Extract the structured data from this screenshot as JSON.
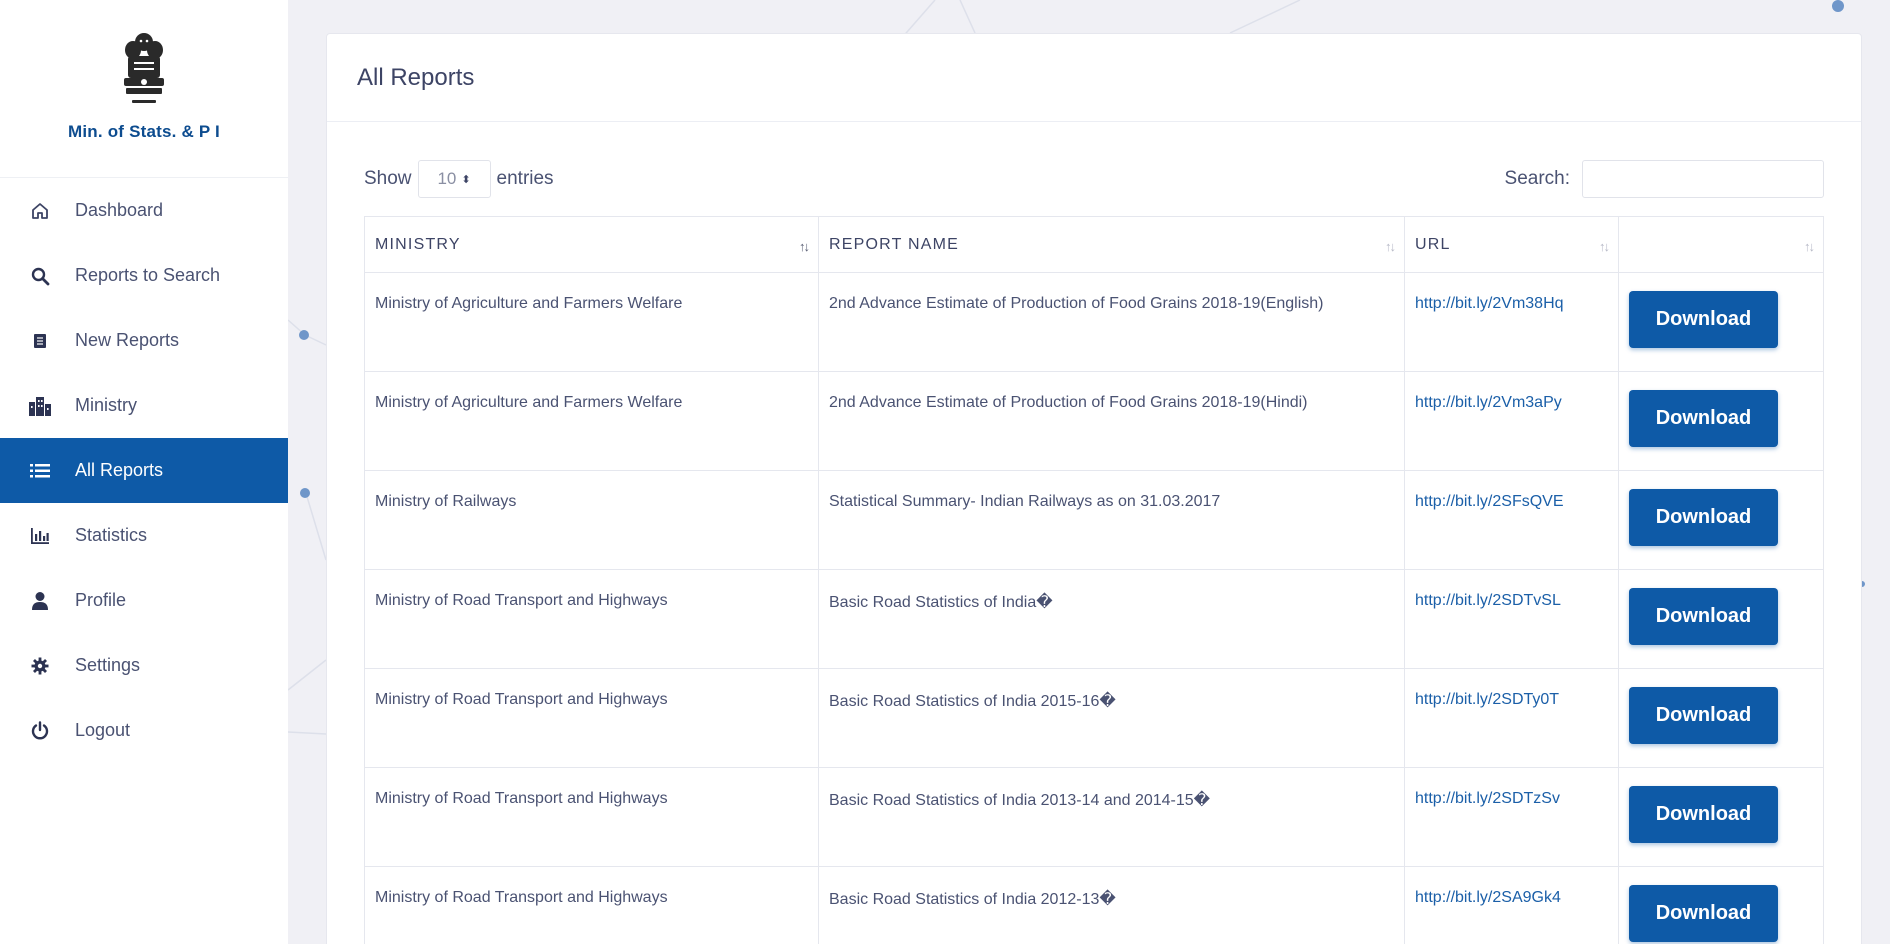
{
  "brand": {
    "name": "Min. of Stats. & P I"
  },
  "nav": [
    {
      "label": "Dashboard",
      "icon": "home-icon",
      "active": false
    },
    {
      "label": "Reports to Search",
      "icon": "search-icon",
      "active": false
    },
    {
      "label": "New Reports",
      "icon": "document-icon",
      "active": false
    },
    {
      "label": "Ministry",
      "icon": "building-icon",
      "active": false
    },
    {
      "label": "All Reports",
      "icon": "list-icon",
      "active": true
    },
    {
      "label": "Statistics",
      "icon": "bar-chart-icon",
      "active": false
    },
    {
      "label": "Profile",
      "icon": "user-icon",
      "active": false
    },
    {
      "label": "Settings",
      "icon": "gear-icon",
      "active": false
    },
    {
      "label": "Logout",
      "icon": "power-icon",
      "active": false
    }
  ],
  "page": {
    "title": "All Reports"
  },
  "table_controls": {
    "show_label": "Show",
    "entries_value": "10",
    "entries_label": "entries",
    "search_label": "Search:",
    "search_value": ""
  },
  "table": {
    "columns": [
      "MINISTRY",
      "REPORT NAME",
      "URL",
      ""
    ],
    "rows": [
      {
        "ministry": "Ministry of Agriculture and Farmers Welfare",
        "report": "2nd Advance Estimate of Production of Food Grains 2018-19(English)",
        "url": "http://bit.ly/2Vm38Hq",
        "action": "Download"
      },
      {
        "ministry": "Ministry of Agriculture and Farmers Welfare",
        "report": "2nd Advance Estimate of Production of Food Grains 2018-19(Hindi)",
        "url": "http://bit.ly/2Vm3aPy",
        "action": "Download"
      },
      {
        "ministry": "Ministry of Railways",
        "report": "Statistical Summary- Indian Railways as on 31.03.2017",
        "url": "http://bit.ly/2SFsQVE",
        "action": "Download"
      },
      {
        "ministry": "Ministry of Road Transport and Highways",
        "report": "Basic Road Statistics of India�",
        "url": "http://bit.ly/2SDTvSL",
        "action": "Download"
      },
      {
        "ministry": "Ministry of Road Transport and Highways",
        "report": "Basic Road Statistics of India 2015-16�",
        "url": "http://bit.ly/2SDTy0T",
        "action": "Download"
      },
      {
        "ministry": "Ministry of Road Transport and Highways",
        "report": "Basic Road Statistics of India 2013-14 and 2014-15�",
        "url": "http://bit.ly/2SDTzSv",
        "action": "Download"
      },
      {
        "ministry": "Ministry of Road Transport and Highways",
        "report": "Basic Road Statistics of India 2012-13�",
        "url": "http://bit.ly/2SA9Gk4",
        "action": "Download"
      }
    ]
  },
  "colors": {
    "primary": "#0e5aa7",
    "brand_text": "#0d4c8f",
    "link": "#1b5fa8"
  }
}
